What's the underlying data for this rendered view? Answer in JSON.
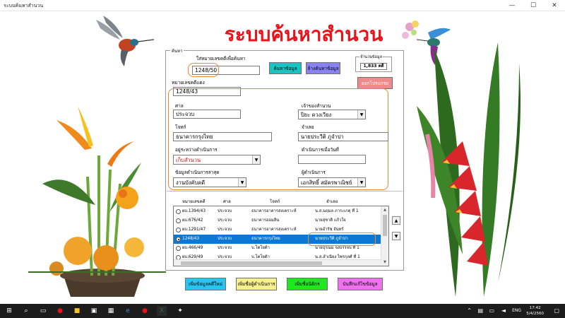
{
  "window": {
    "title": "ระบบค้นหาสำนวน",
    "minimize": "—",
    "maximize": "☐",
    "close": "✕"
  },
  "app_title": "ระบบค้นหาสำนวน",
  "frame_label": "ค้นหา",
  "search": {
    "label": "ใส่หมายเลขคดีเพื่อค้นหา",
    "value": "1248/50",
    "search_button": "ค้นหาข้อมูล",
    "clear_button": "ล้างค้นหาข้อมูล"
  },
  "record_count": {
    "label": "จำนวนข้อมูล",
    "value": "1,833 คดี"
  },
  "exit_button": "ออกโปรแกรม",
  "detail": {
    "case_number_label": "หมายเลขคดีแดง",
    "case_number": "1248/43",
    "court_label": "ศาล",
    "court": "ประจวบ",
    "owner_label": "เจ้าของสำนวน",
    "owner": "ปิยะ ดวงเวียง",
    "plaintiff_label": "โจทก์",
    "plaintiff": "ธนาคารกรุงไทย",
    "defendant_label": "จำเลย",
    "defendant": "นายประวีติ ภูจำปา",
    "status_label": "อยู่ระหว่างดำเนินการ",
    "status": "เก็บสำนวน",
    "last_action_date_label": "ดำเนินการเมื่อวันที่",
    "last_action_date": "",
    "last_action_label": "ข้อมูลดำเนินการล่าสุด",
    "last_action": "งานบังคับคดี",
    "operator_label": "ผู้ดำเนินการ",
    "operator": "เอกสิทธิ์ สมัครพาณิชย์"
  },
  "list": {
    "columns": [
      "หมายเลขคดี",
      "ศาล",
      "โจทก์",
      "จำเลย"
    ],
    "rows": [
      {
        "case": "ผบ.1394/43",
        "court": "ประจวบ",
        "plaintiff": "ธนาคารอาคารสงเคราะห์",
        "defendant": "น.ส.นฤมล ภาระเกตุ ที่ 1",
        "selected": false
      },
      {
        "case": "ผบ.676/42",
        "court": "ประจวบ",
        "plaintiff": "ธนาคารออมสิน",
        "defendant": "นายสุชาติ แก้วใจ",
        "selected": false
      },
      {
        "case": "ผบ.1291/47",
        "court": "ประจวบ",
        "plaintiff": "ธนาคารอาคารสงเคราะห์",
        "defendant": "นายอำรัช จันทร์",
        "selected": false
      },
      {
        "case": "1248/43",
        "court": "ประจวบ",
        "plaintiff": "ธนาคารกรุงไทย",
        "defendant": "นายประวีติ ภูจำปา",
        "selected": true
      },
      {
        "case": "ผบ.466/49",
        "court": "ประจวบ",
        "plaintiff": "บ.โตโยต้า",
        "defendant": "นายปุรณม จงบรรจบ ที่ 1",
        "selected": false
      },
      {
        "case": "ผบ.629/49",
        "court": "ประจวบ",
        "plaintiff": "บ.โตโยต้า",
        "defendant": "น.ส.ลำเนียง ไพรกุลศ์ ที่ 1",
        "selected": false
      }
    ]
  },
  "buttons": {
    "add_case": "เพิ่มข้อมูลคดีใหม่",
    "add_operator": "เพิ่มชื่อผู้ดำเนินการ",
    "add_employee": "เพิ่มชื่อนิติกร",
    "save_changes": "บันทึกแก้ไขข้อมูล"
  },
  "colors": {
    "title_red": "#e8141b",
    "search_btn": "#1cc2c2",
    "clear_btn": "#8a82f2",
    "exit_btn": "#f08a8a",
    "add_case_btn": "#27c6f0",
    "add_operator_btn": "#f7f08c",
    "add_employee_btn": "#1fe81f",
    "save_btn": "#f071f0",
    "selection": "#0a78d4",
    "highlight_outline": "#e8892c"
  },
  "taskbar": {
    "lang": "ENG",
    "time": "17:42",
    "date": "5/4/2560"
  }
}
